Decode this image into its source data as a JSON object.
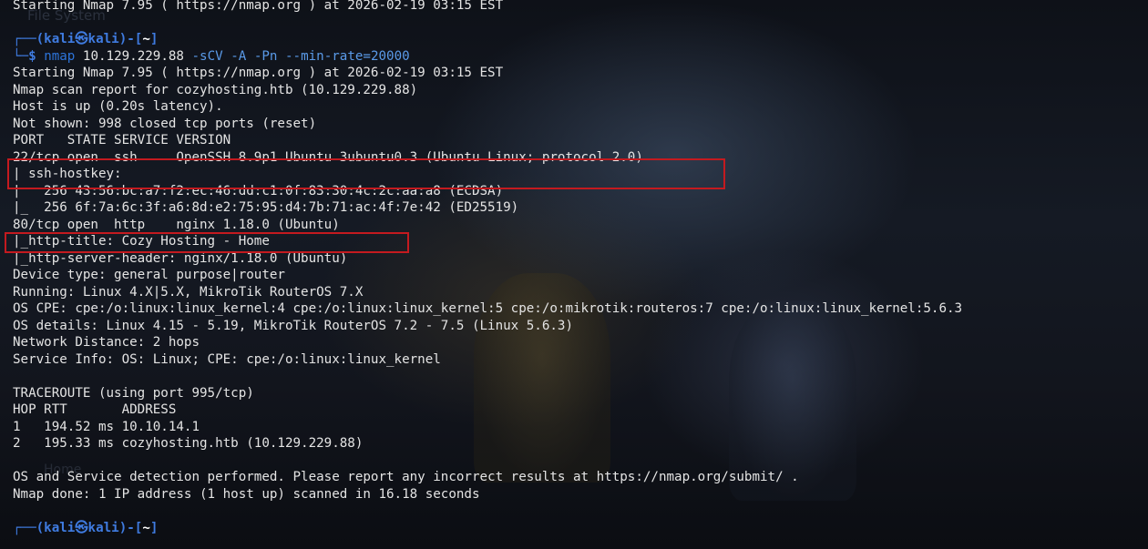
{
  "terminal": {
    "top_line": "Starting Nmap 7.95 ( https://nmap.org ) at 2026-02-19 03:15 EST",
    "ghost_text": "File System",
    "ghost_text2": "Home",
    "prompt": {
      "open": "┌──(",
      "user": "kali",
      "at": "㉿",
      "host": "kali",
      "close": ")-[",
      "dir": "~",
      "end": "]",
      "dollar_prefix": "└─",
      "dollar": "$"
    },
    "command": {
      "bin": "nmap",
      "target": "10.129.229.88",
      "args": "-sCV -A -Pn --min-rate=20000"
    },
    "output": [
      "Starting Nmap 7.95 ( https://nmap.org ) at 2026-02-19 03:15 EST",
      "Nmap scan report for cozyhosting.htb (10.129.229.88)",
      "Host is up (0.20s latency).",
      "Not shown: 998 closed tcp ports (reset)",
      "PORT   STATE SERVICE VERSION",
      "22/tcp open  ssh     OpenSSH 8.9p1 Ubuntu 3ubuntu0.3 (Ubuntu Linux; protocol 2.0)",
      "| ssh-hostkey: ",
      "|   256 43:56:bc:a7:f2:ec:46:dd:c1:0f:83:30:4c:2c:aa:a8 (ECDSA)",
      "|_  256 6f:7a:6c:3f:a6:8d:e2:75:95:d4:7b:71:ac:4f:7e:42 (ED25519)",
      "80/tcp open  http    nginx 1.18.0 (Ubuntu)",
      "|_http-title: Cozy Hosting - Home",
      "|_http-server-header: nginx/1.18.0 (Ubuntu)",
      "Device type: general purpose|router",
      "Running: Linux 4.X|5.X, MikroTik RouterOS 7.X",
      "OS CPE: cpe:/o:linux:linux_kernel:4 cpe:/o:linux:linux_kernel:5 cpe:/o:mikrotik:routeros:7 cpe:/o:linux:linux_kernel:5.6.3",
      "OS details: Linux 4.15 - 5.19, MikroTik RouterOS 7.2 - 7.5 (Linux 5.6.3)",
      "Network Distance: 2 hops",
      "Service Info: OS: Linux; CPE: cpe:/o:linux:linux_kernel",
      "",
      "TRACEROUTE (using port 995/tcp)",
      "HOP RTT       ADDRESS",
      "1   194.52 ms 10.10.14.1",
      "2   195.33 ms cozyhosting.htb (10.129.229.88)",
      "",
      "OS and Service detection performed. Please report any incorrect results at https://nmap.org/submit/ .",
      "Nmap done: 1 IP address (1 host up) scanned in 16.18 seconds"
    ],
    "colors": {
      "highlight_box": "#c41a1f",
      "prompt_blue": "#3f7be0",
      "text": "#e4e4e4"
    }
  }
}
